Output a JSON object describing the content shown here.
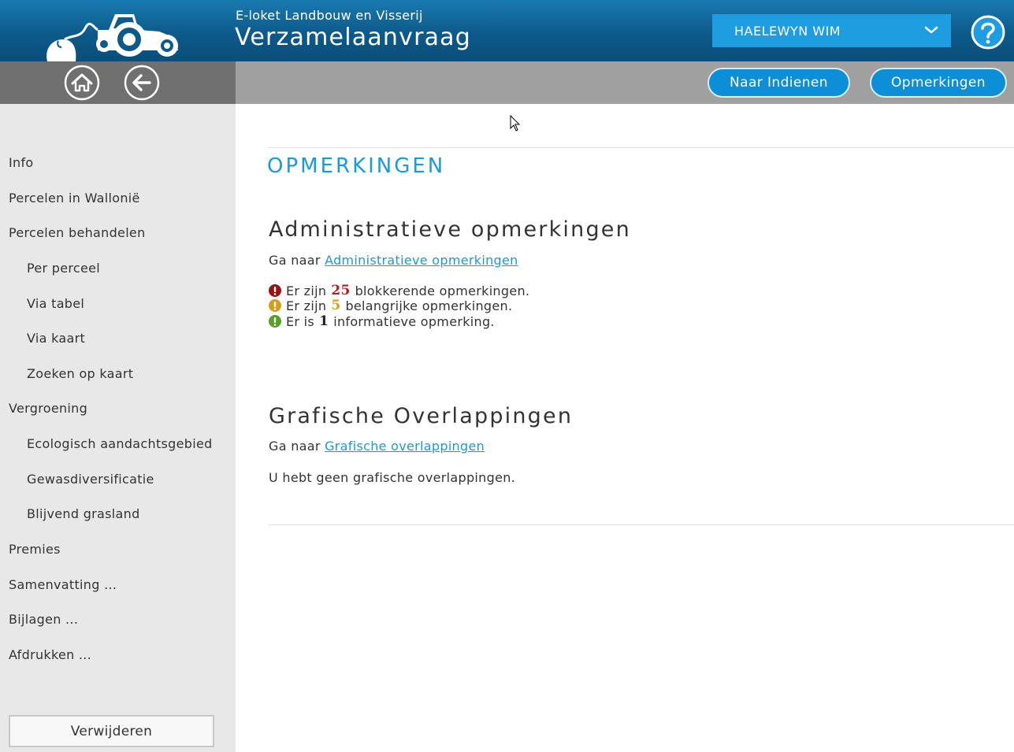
{
  "header": {
    "subtitle": "E-loket Landbouw en Visserij",
    "title": "Verzamelaanvraag",
    "user": "HAELEWYN WIM"
  },
  "toolbar": {
    "submit_label": "Naar Indienen",
    "remarks_label": "Opmerkingen"
  },
  "sidebar": {
    "items": [
      {
        "label": "Info"
      },
      {
        "label": "Percelen in Wallonië"
      },
      {
        "label": "Percelen behandelen"
      },
      {
        "label": "Per perceel"
      },
      {
        "label": "Via tabel"
      },
      {
        "label": "Via kaart"
      },
      {
        "label": "Zoeken op kaart"
      },
      {
        "label": "Vergroening"
      },
      {
        "label": "Ecologisch aandachtsgebied"
      },
      {
        "label": "Gewasdiversificatie"
      },
      {
        "label": "Blijvend grasland"
      },
      {
        "label": "Premies"
      },
      {
        "label": "Samenvatting ..."
      },
      {
        "label": "Bijlagen ..."
      },
      {
        "label": "Afdrukken ..."
      }
    ],
    "delete_label": "Verwijderen"
  },
  "main": {
    "heading": "OPMERKINGEN",
    "admin": {
      "title": "Administratieve opmerkingen",
      "goto_prefix": "Ga naar",
      "goto_link": "Administratieve opmerkingen",
      "messages": [
        {
          "prefix": "Er zijn",
          "count": "25",
          "suffix": "blokkerende opmerkingen.",
          "color": "#b01e1e",
          "icon": "error-icon"
        },
        {
          "prefix": "Er zijn",
          "count": "5",
          "suffix": "belangrijke opmerkingen.",
          "color": "#d4a017",
          "icon": "warning-icon"
        },
        {
          "prefix": "Er is",
          "count": "1",
          "suffix": "informatieve opmerking.",
          "color": "#5a9e2a",
          "icon": "info-icon"
        }
      ]
    },
    "overlap": {
      "title": "Grafische Overlappingen",
      "goto_prefix": "Ga naar",
      "goto_link": "Grafische overlappingen",
      "status": "U hebt geen grafische overlappingen."
    }
  },
  "colors": {
    "accent": "#1b9bd6",
    "header": "#0c5a8a",
    "error": "#b01e1e",
    "warning": "#d4a017",
    "info": "#5a9e2a"
  }
}
